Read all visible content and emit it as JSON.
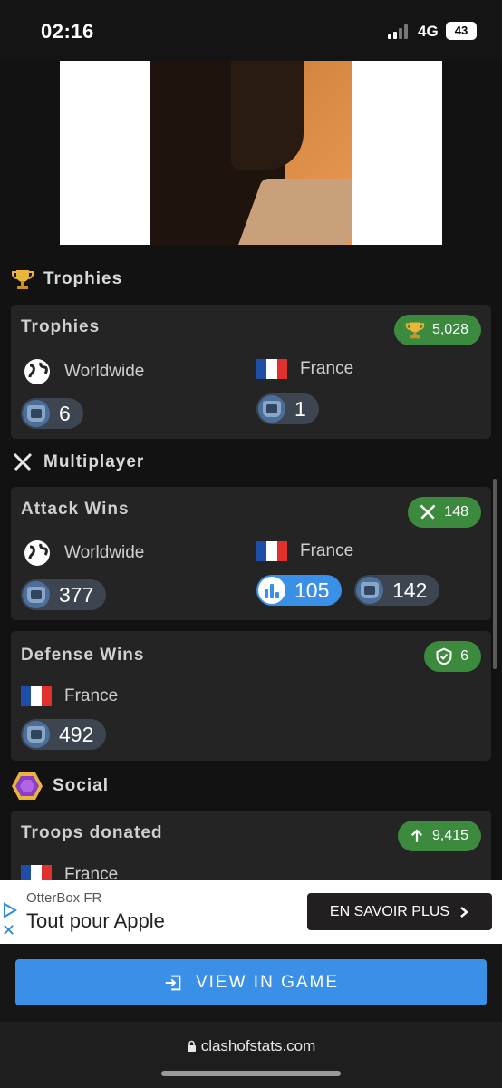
{
  "status": {
    "time": "02:16",
    "network": "4G",
    "battery": "43"
  },
  "sections": {
    "trophies": "Trophies",
    "multiplayer": "Multiplayer",
    "social": "Social"
  },
  "trophies_card": {
    "title": "Trophies",
    "badge": "5,028",
    "worldwide_label": "Worldwide",
    "worldwide_rank": "6",
    "france_label": "France",
    "france_rank": "1"
  },
  "attack_card": {
    "title": "Attack Wins",
    "badge": "148",
    "worldwide_label": "Worldwide",
    "worldwide_rank": "377",
    "france_label": "France",
    "france_rank_blue": "105",
    "france_rank": "142"
  },
  "defense_card": {
    "title": "Defense Wins",
    "badge": "6",
    "france_label": "France",
    "france_rank": "492"
  },
  "donated_card": {
    "title": "Troops donated",
    "badge": "9,415",
    "france_label": "France"
  },
  "ad": {
    "brand": "OtterBox FR",
    "title": "Tout pour Apple",
    "cta": "EN SAVOIR PLUS"
  },
  "view_button": "VIEW IN GAME",
  "url": "clashofstats.com",
  "colors": {
    "accent_blue": "#3a8fe6",
    "badge_green": "#3c8a3e",
    "card_bg": "#242424"
  }
}
